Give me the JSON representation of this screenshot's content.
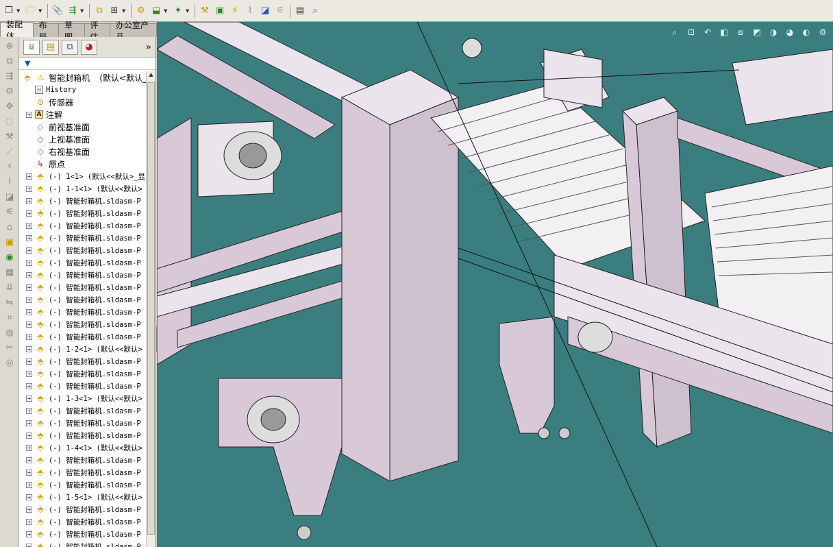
{
  "toolbar": {
    "icons": [
      "new-doc-icon",
      "open-folder-icon",
      "paperclip-icon",
      "assembly-insert-icon",
      "mate-icon",
      "component-pattern-icon",
      "smart-fastener-icon",
      "move-component-icon",
      "show-hidden-icon",
      "assembly-feature-icon",
      "reference-geometry-icon",
      "new-motion-study-icon",
      "bill-of-materials-icon",
      "exploded-view-icon",
      "explode-line-icon",
      "interference-icon",
      "clearance-icon",
      "hole-alignment-icon",
      "instant3d-icon"
    ]
  },
  "command_tabs": [
    "装配体",
    "布局",
    "草图",
    "评估",
    "办公室产品"
  ],
  "feature_manager": {
    "tabs": [
      "feature-tree-tab",
      "property-manager-tab",
      "configuration-manager-tab",
      "appearance-tab"
    ],
    "more": "»",
    "filter_icon": "filter-icon",
    "root": {
      "label": "智能封箱机",
      "config": "(默认<默认_"
    },
    "fixed_items": [
      {
        "label": "History",
        "icon": "history-icon"
      },
      {
        "label": "传感器",
        "icon": "sensor-icon"
      },
      {
        "label": "注解",
        "icon": "annotation-icon",
        "expand": true
      },
      {
        "label": "前视基准面",
        "icon": "plane-icon"
      },
      {
        "label": "上视基准面",
        "icon": "plane-icon"
      },
      {
        "label": "右视基准面",
        "icon": "plane-icon"
      },
      {
        "label": "原点",
        "icon": "origin-icon"
      }
    ],
    "components": [
      "(-) 1<1> (默认<<默认>_显",
      "(-) 1-1<1> (默认<<默认>",
      "(-) 智能封箱机.sldasm-P",
      "(-) 智能封箱机.sldasm-P",
      "(-) 智能封箱机.sldasm-P",
      "(-) 智能封箱机.sldasm-P",
      "(-) 智能封箱机.sldasm-P",
      "(-) 智能封箱机.sldasm-P",
      "(-) 智能封箱机.sldasm-P",
      "(-) 智能封箱机.sldasm-P",
      "(-) 智能封箱机.sldasm-P",
      "(-) 智能封箱机.sldasm-P",
      "(-) 智能封箱机.sldasm-P",
      "(-) 智能封箱机.sldasm-P",
      "(-) 1-2<1> (默认<<默认>",
      "(-) 智能封箱机.sldasm-P",
      "(-) 智能封箱机.sldasm-P",
      "(-) 智能封箱机.sldasm-P",
      "(-) 1-3<1> (默认<<默认>",
      "(-) 智能封箱机.sldasm-P",
      "(-) 智能封箱机.sldasm-P",
      "(-) 智能封箱机.sldasm-P",
      "(-) 1-4<1> (默认<<默认>",
      "(-) 智能封箱机.sldasm-P",
      "(-) 智能封箱机.sldasm-P",
      "(-) 智能封箱机.sldasm-P",
      "(-) 1-5<1> (默认<<默认>",
      "(-) 智能封箱机.sldasm-P",
      "(-) 智能封箱机.sldasm-P",
      "(-) 智能封箱机.sldasm-P",
      "(-) 智能封箱机.sldasm-P"
    ]
  },
  "viewport": {
    "background": "#3a7e80",
    "frame_color": "#d8c8d8",
    "view_tools": [
      "zoom-to-fit-icon",
      "zoom-area-icon",
      "previous-view-icon",
      "section-view-icon",
      "view-orientation-icon",
      "display-style-icon",
      "hide-show-icon",
      "appearance-icon",
      "scene-icon",
      "display-settings-icon"
    ]
  },
  "colors": {
    "accent_frame": "#d8c8d8",
    "panel_bg": "#ffffff",
    "chrome": "#d4d0c8"
  }
}
